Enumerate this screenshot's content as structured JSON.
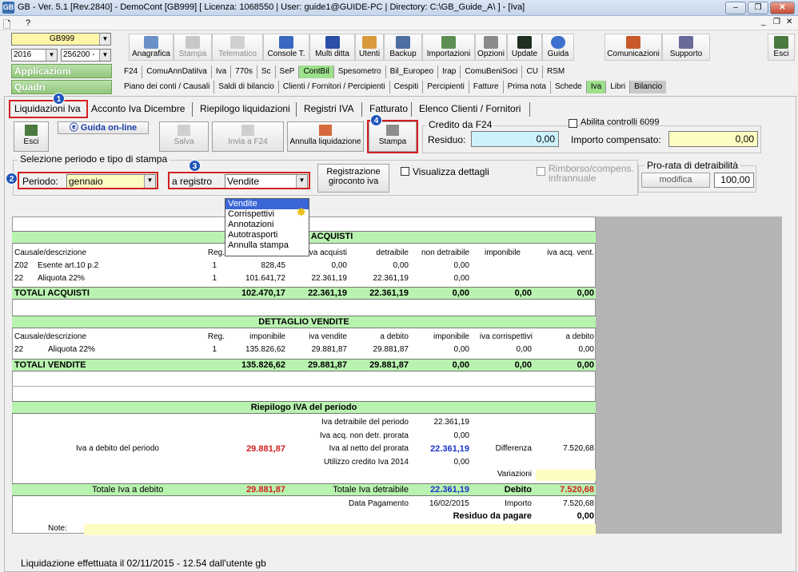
{
  "window": {
    "title": "GB - Ver. 5.1 [Rev.2840] - DemoCont [GB999]    [ Licenza: 1068550 | User: guide1@GUIDE-PC | Directory: C:\\GB_Guide_A\\ ] - [Iva]",
    "app_icon": "GB"
  },
  "menu": {
    "doc_icon": "new-document-icon",
    "help": "?"
  },
  "selectors": {
    "company": "GB999",
    "year": "2016",
    "code": "256200 -"
  },
  "toolbar": {
    "items": [
      "Anagrafica",
      "Stampa",
      "Telematico",
      "Console T.",
      "Multi ditta",
      "Utenti",
      "Backup",
      "Importazioni",
      "Opzioni",
      "Update",
      "Guida",
      "Comunicazioni",
      "Supporto",
      "Esci"
    ]
  },
  "sections": {
    "applicazioni": "Applicazioni",
    "quadri": "Quadri"
  },
  "nav1": [
    "F24",
    "ComuAnnDatiIva",
    "Iva",
    "770s",
    "Sc",
    "SeP",
    "ContBil",
    "Spesometro",
    "Bil_Europeo",
    "Irap",
    "ComuBeniSoci",
    "CU",
    "RSM"
  ],
  "nav2": [
    "Piano dei conti / Causali",
    "Saldi di bilancio",
    "Clienti / Fornitori / Percipienti",
    "Cespiti",
    "Percipienti",
    "Fatture",
    "Prima nota",
    "Schede",
    "Iva",
    "Libri",
    "Bilancio"
  ],
  "tabs": [
    "Liquidazioni Iva",
    "Acconto Iva Dicembre",
    "Riepilogo liquidazioni",
    "Registri IVA",
    "Fatturato",
    "Elenco Clienti / Fornitori"
  ],
  "badges": [
    "1",
    "2",
    "3",
    "4"
  ],
  "actions": {
    "esci": "Esci",
    "guida": "Guida on-line",
    "salva": "Salva",
    "invia": "Invia a F24",
    "annulla": "Annulla liquidazione",
    "stampa": "Stampa"
  },
  "credito": {
    "group": "Credito da F24",
    "residuo_label": "Residuo:",
    "residuo": "0,00",
    "abilita": "Abilita controlli 6099",
    "importo_label": "Importo compensato:",
    "importo": "0,00"
  },
  "selezione": {
    "group": "Selezione periodo e tipo di stampa",
    "periodo_label": "Periodo:",
    "periodo": "gennaio",
    "registro_label": "a registro",
    "registro": "Vendite",
    "reg_giroconto": "Registrazione giroconto iva",
    "visualizza": "Visualizza dettagli",
    "rimborso": "Rimborso/compens. infrannuale"
  },
  "prorata": {
    "group": "Pro-rata di detraibilità",
    "modifica": "modifica",
    "value": "100,00"
  },
  "dropdown": [
    "Vendite",
    "Corrispettivi",
    "Annotazioni",
    "Autotrasporti",
    "Annulla stampa"
  ],
  "acquisti": {
    "title": "ACQUISTI",
    "cols": [
      "Causale/descrizione",
      "Reg.",
      "imponibile",
      "iva acquisti",
      "detraibile",
      "non detraibile",
      "imponibile",
      "iva acq. vent."
    ],
    "rows": [
      [
        "Z02",
        "Esente art.10 p.2",
        "1",
        "828,45",
        "0,00",
        "0,00",
        "0,00",
        "",
        ""
      ],
      [
        "22",
        "Aliquota 22%",
        "1",
        "101.641,72",
        "22.361,19",
        "22.361,19",
        "0,00",
        "",
        ""
      ]
    ],
    "totals": [
      "TOTALI ACQUISTI",
      "102.470,17",
      "22.361,19",
      "22.361,19",
      "0,00",
      "0,00",
      "0,00"
    ]
  },
  "vendite": {
    "title": "DETTAGLIO VENDITE",
    "cols": [
      "Causale/descrizione",
      "Reg.",
      "imponibile",
      "iva vendite",
      "a debito",
      "imponibile",
      "iva corrispettivi",
      "a debito"
    ],
    "rows": [
      [
        "22",
        "Aliquota 22%",
        "1",
        "135.826,62",
        "29.881,87",
        "29.881,87",
        "0,00",
        "0,00",
        "0,00"
      ]
    ],
    "totals": [
      "TOTALI VENDITE",
      "135.826,62",
      "29.881,87",
      "29.881,87",
      "0,00",
      "0,00",
      "0,00"
    ]
  },
  "riepilogo": {
    "title": "Riepilogo IVA del periodo",
    "detraibile_label": "Iva detraibile del periodo",
    "detraibile": "22.361,19",
    "acq_nondetr_label": "Iva acq. non detr. prorata",
    "acq_nondetr": "0,00",
    "debito_label": "Iva a debito del periodo",
    "debito": "29.881,87",
    "netto_label": "Iva al netto del prorata",
    "netto": "22.361,19",
    "differenza_label": "Differenza",
    "differenza": "7.520,68",
    "utilizzo_label": "Utilizzo credito Iva 2014",
    "utilizzo": "0,00",
    "variazioni_label": "Variazioni",
    "tot_debito_label": "Totale Iva a debito",
    "tot_debito": "29.881,87",
    "tot_detr_label": "Totale Iva detraibile",
    "tot_detr": "22.361,19",
    "debito2_label": "Debito",
    "debito2": "7.520,68",
    "data_label": "Data Pagamento",
    "data": "16/02/2015",
    "importo_label": "Importo",
    "importo": "7.520,68",
    "residuo_label": "Residuo da pagare",
    "residuo": "0,00",
    "note_label": "Note:"
  },
  "status": "Liquidazione effettuata il 02/11/2015 - 12.54 dall'utente gb"
}
